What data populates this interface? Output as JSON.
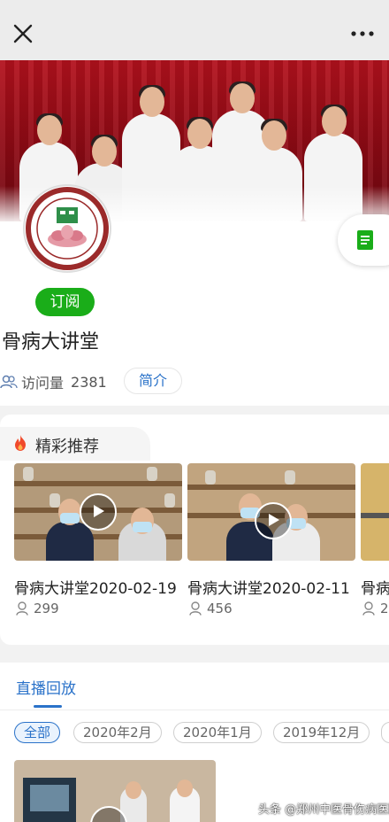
{
  "topbar": {
    "close_icon": "close-icon",
    "more_icon": "more-dots-icon"
  },
  "profile": {
    "logo_icon": "hospital-logo-icon",
    "side_icon": "document-icon",
    "subscribe_label": "订阅",
    "title": "骨病大讲堂",
    "visits_label": "访问量",
    "visits_count": "2381",
    "intro_label": "简介",
    "accent_green": "#1aad19",
    "accent_blue": "#2a72c9"
  },
  "recommended": {
    "title": "精彩推荐",
    "icon": "fire-icon",
    "videos": [
      {
        "title": "骨病大讲堂2020-02-19",
        "views": "299"
      },
      {
        "title": "骨病大讲堂2020-02-11",
        "views": "456"
      },
      {
        "title": "骨病",
        "views": "2"
      }
    ]
  },
  "live": {
    "tab_label": "直播回放",
    "filters": [
      "全部",
      "2020年2月",
      "2020年1月",
      "2019年12月"
    ],
    "active_filter": "全部"
  },
  "watermark": "头条 @郑州中医骨伤病医院"
}
